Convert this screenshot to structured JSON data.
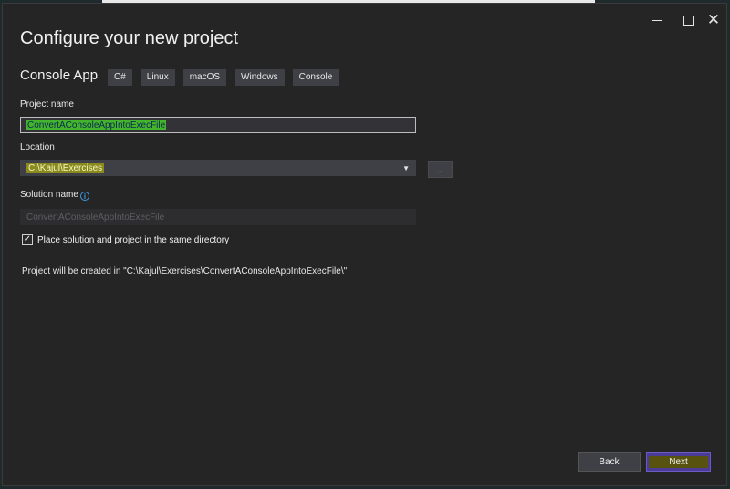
{
  "window": {
    "minimize_icon": "minimize-icon",
    "maximize_icon": "maximize-icon",
    "close_glyph": "✕"
  },
  "header": {
    "title": "Configure your new project",
    "template_name": "Console App",
    "tags": [
      "C#",
      "Linux",
      "macOS",
      "Windows",
      "Console"
    ]
  },
  "form": {
    "project_name": {
      "label": "Project name",
      "value": "ConvertAConsoleAppIntoExecFile"
    },
    "location": {
      "label": "Location",
      "value": "C:\\Kajul\\Exercises",
      "browse_label": "...",
      "dropdown_glyph": "▼"
    },
    "solution_name": {
      "label": "Solution name",
      "info_glyph": "i",
      "placeholder": "ConvertAConsoleAppIntoExecFile"
    },
    "same_directory": {
      "checked_glyph": "✓",
      "label": "Place solution and project in the same directory"
    },
    "created_path_text": "Project will be created in \"C:\\Kajul\\Exercises\\ConvertAConsoleAppIntoExecFile\\\""
  },
  "footer": {
    "back_label": "Back",
    "next_label": "Next"
  },
  "colors": {
    "background": "#252526",
    "accent": "#4b3b96",
    "highlight_green": "#43b52c",
    "highlight_yellow": "#8a8a1f"
  }
}
